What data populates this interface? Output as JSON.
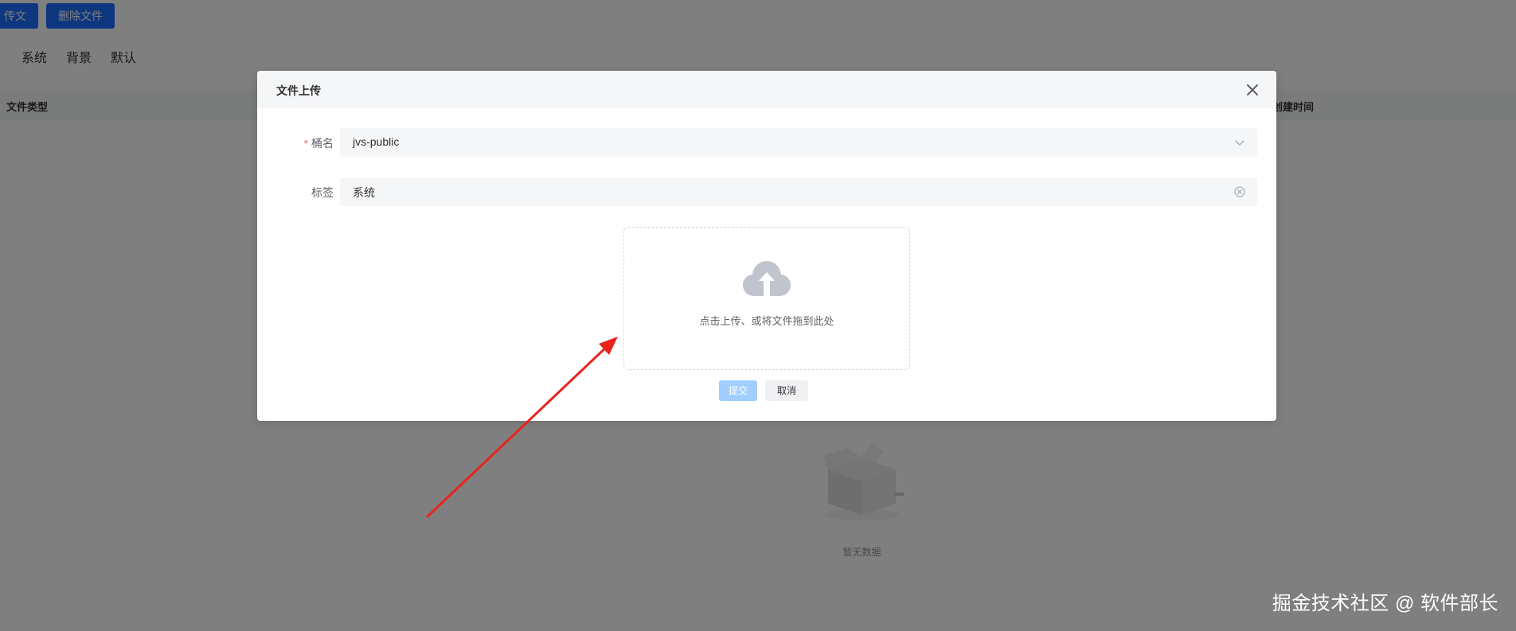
{
  "toolbar": {
    "upload_label": "上传文件",
    "upload_label_visible": "传文件",
    "delete_label": "删除文件"
  },
  "tabs": [
    "系统",
    "背景",
    "默认"
  ],
  "table": {
    "columns": {
      "file_type": "文件类型",
      "created_time": "创建时间"
    },
    "empty_text": "暂无数据"
  },
  "dialog": {
    "title": "文件上传",
    "bucket": {
      "label": "桶名",
      "required_mark": "*",
      "value": "jvs-public"
    },
    "tag": {
      "label": "标签",
      "value": "系统"
    },
    "upload_hint": "点击上传、或将文件拖到此处",
    "submit_label": "提交",
    "cancel_label": "取消"
  },
  "watermark": "掘金技术社区 @ 软件部长",
  "colors": {
    "primary": "#1e6fff",
    "submit_disabled": "#a0cfff",
    "annotation_arrow": "#e8231c",
    "required": "#f56c6c"
  }
}
